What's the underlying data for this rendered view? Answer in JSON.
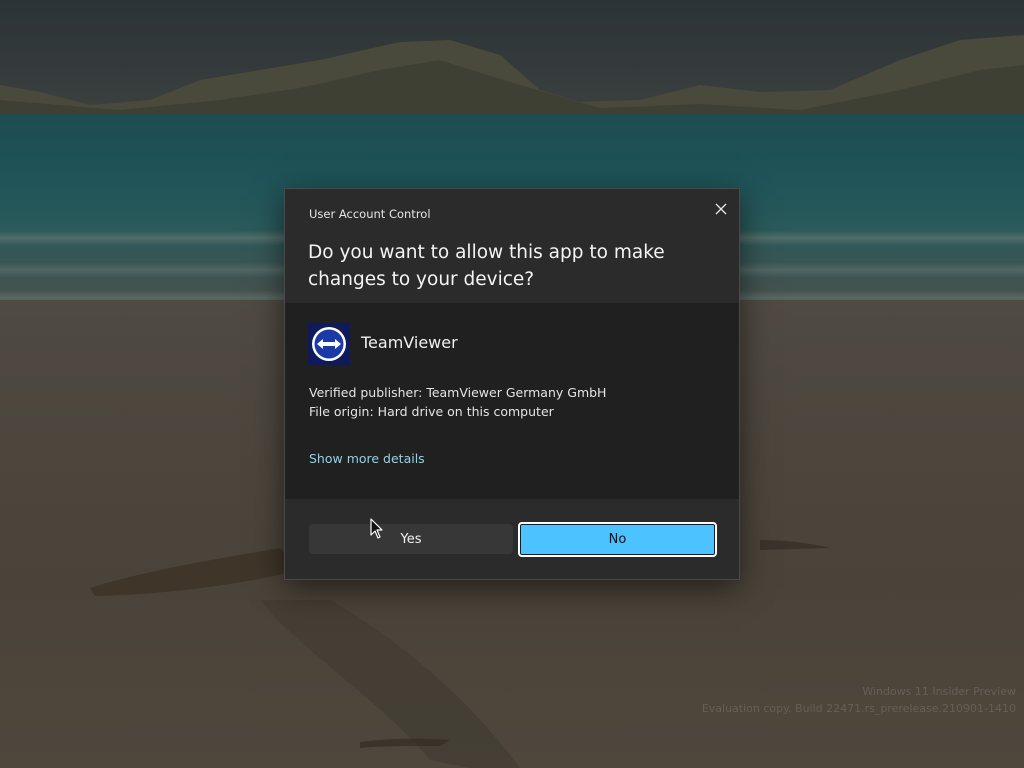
{
  "dialog": {
    "title": "User Account Control",
    "heading": "Do you want to allow this app to make changes to your device?",
    "app": {
      "name": "TeamViewer",
      "icon": "teamviewer-icon"
    },
    "publisher_line": "Verified publisher: TeamViewer Germany GmbH",
    "origin_line": "File origin: Hard drive on this computer",
    "more_details_link": "Show more details",
    "buttons": {
      "yes_label": "Yes",
      "no_label": "No"
    },
    "close_icon": "close-icon"
  },
  "desktop": {
    "watermark_line1": "Windows 11 Insider Preview",
    "watermark_line2": "Evaluation copy. Build 22471.rs_prerelease.210901-1410"
  },
  "colors": {
    "accent": "#4cc2ff",
    "link": "#8fd2e6",
    "dialog_bg": "#2b2b2b",
    "dialog_body_bg": "#202020"
  }
}
